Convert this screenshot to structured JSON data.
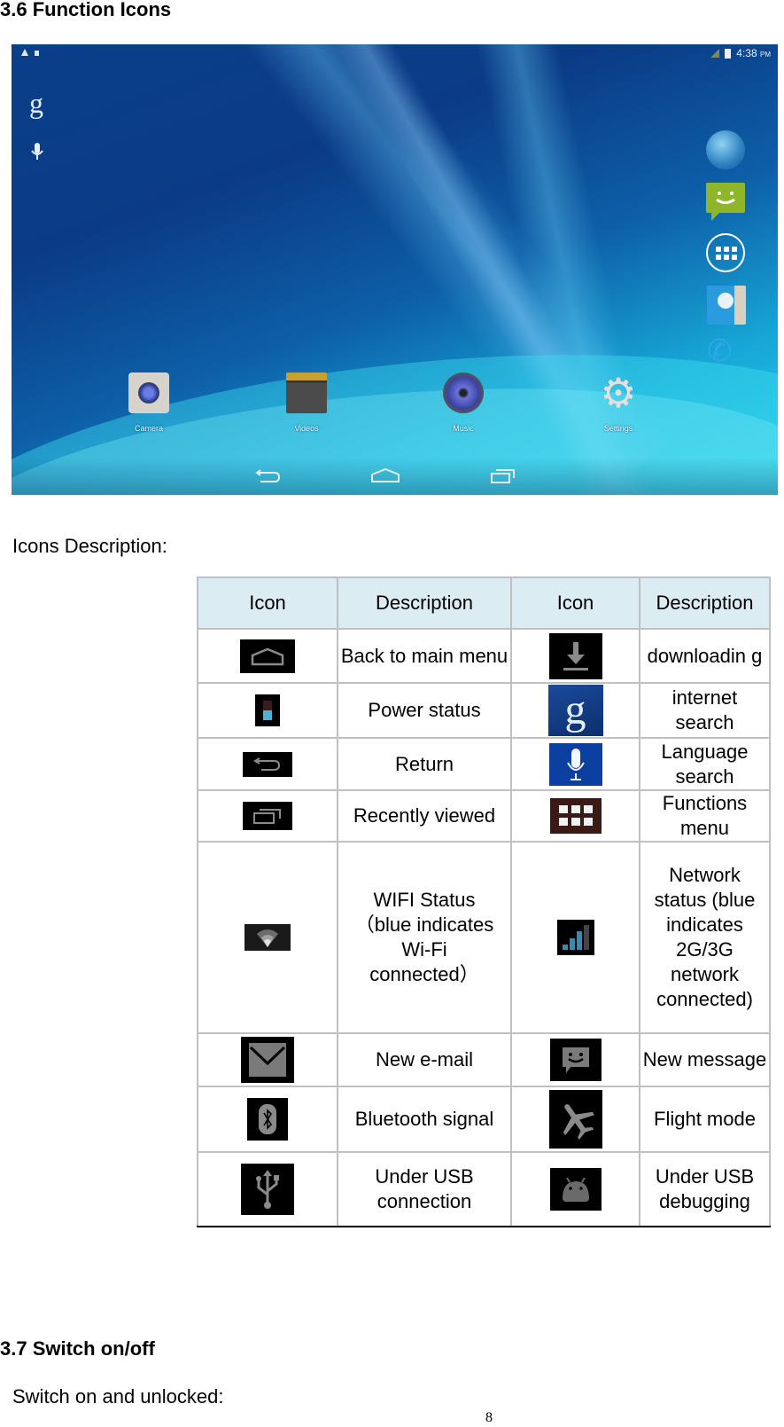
{
  "section_36": {
    "title": "3.6 Function Icons"
  },
  "tablet": {
    "status_time": "4:38",
    "status_ampm": "PM",
    "left_icons": [
      "google-search-icon",
      "voice-search-icon"
    ],
    "right_dock_icons": [
      "browser-icon",
      "messaging-icon",
      "all-apps-icon",
      "contacts-icon",
      "phone-icon"
    ],
    "dock": [
      {
        "label": "Camera",
        "icon": "camera-icon"
      },
      {
        "label": "Videos",
        "icon": "videos-icon"
      },
      {
        "label": "Music",
        "icon": "music-icon"
      },
      {
        "label": "Settings",
        "icon": "settings-icon"
      }
    ],
    "nav": [
      "back-icon",
      "home-icon",
      "recents-icon"
    ],
    "glyphs": {
      "settings": "⚙",
      "phone": "✆",
      "google": "g"
    }
  },
  "icons_description_label": "Icons Description:",
  "table": {
    "headers": [
      "Icon",
      "Description",
      "Icon",
      "Description"
    ],
    "rows": [
      {
        "left_icon": "home-icon",
        "left_desc": "Back to main menu",
        "right_icon": "download-icon",
        "right_desc": "downloadin g"
      },
      {
        "left_icon": "battery-icon",
        "left_desc": "Power status",
        "right_icon": "google-search-icon",
        "right_desc": "internet search"
      },
      {
        "left_icon": "back-icon",
        "left_desc": "Return",
        "right_icon": "microphone-icon",
        "right_desc": "Language search"
      },
      {
        "left_icon": "recents-icon",
        "left_desc": "Recently viewed",
        "right_icon": "apps-grid-icon",
        "right_desc": "Functions menu"
      },
      {
        "left_icon": "wifi-icon",
        "left_desc": "WIFI Status（blue indicates Wi-Fi connected）",
        "right_icon": "signal-icon",
        "right_desc": "Network status (blue indicates 2G/3G network connected)"
      },
      {
        "left_icon": "email-icon",
        "left_desc": "New e-mail",
        "right_icon": "message-icon",
        "right_desc": "New message"
      },
      {
        "left_icon": "bluetooth-icon",
        "left_desc": "Bluetooth signal",
        "right_icon": "airplane-icon",
        "right_desc": "Flight mode"
      },
      {
        "left_icon": "usb-icon",
        "left_desc": "Under USB connection",
        "right_icon": "android-debug-icon",
        "right_desc": "Under USB debugging"
      }
    ]
  },
  "section_37": {
    "title": "3.7 Switch on/off",
    "text": "Switch on and unlocked:"
  },
  "page_number": "8"
}
